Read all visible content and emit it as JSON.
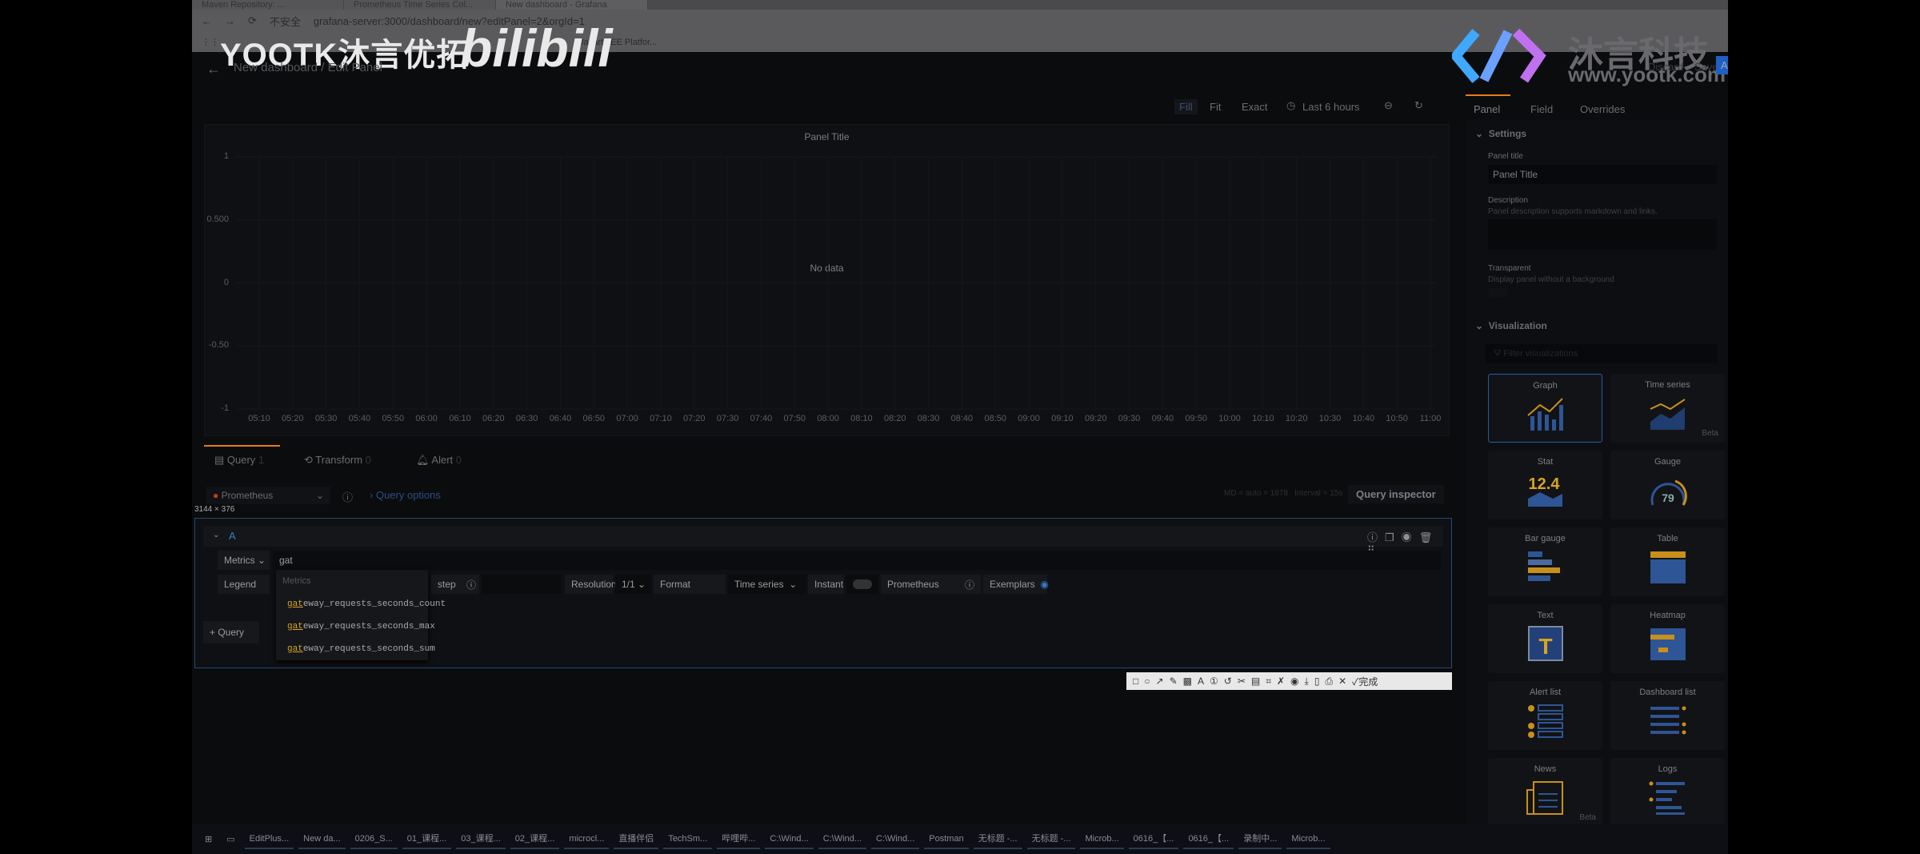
{
  "browser": {
    "tabs": [
      "Maven Repository: ...",
      "Prometheus Time Series Col...",
      "New dashboard - Grafana"
    ],
    "security": "不安全",
    "url": "grafana-server:3000/dashboard/new?editPanel=2&orgId=1",
    "bookmark": "Jakarta EE Platfor..."
  },
  "watermark": {
    "left": "YOOTK沐言优拓",
    "bili": "bilibili",
    "right_cn": "沐言科技",
    "right_url": "www.yootk.com"
  },
  "header": {
    "breadcrumb": "New dashboard / Edit Panel",
    "discard": "Discard",
    "save": "Save",
    "apply": "Apply"
  },
  "toolbar": {
    "fill": "Fill",
    "fit": "Fit",
    "exact": "Exact",
    "time_range": "Last 6 hours"
  },
  "panel": {
    "title": "Panel Title",
    "no_data": "No data"
  },
  "chart_data": {
    "type": "line",
    "title": "Panel Title",
    "y_ticks": [
      "1",
      "0.500",
      "0",
      "-0.50",
      "-1"
    ],
    "ylim": [
      -1,
      1
    ],
    "x_ticks": [
      "05:10",
      "05:20",
      "05:30",
      "05:40",
      "05:50",
      "06:00",
      "06:10",
      "06:20",
      "06:30",
      "06:40",
      "06:50",
      "07:00",
      "07:10",
      "07:20",
      "07:30",
      "07:40",
      "07:50",
      "08:00",
      "08:10",
      "08:20",
      "08:30",
      "08:40",
      "08:50",
      "09:00",
      "09:10",
      "09:20",
      "09:30",
      "09:40",
      "09:50",
      "10:00",
      "10:10",
      "10:20",
      "10:30",
      "10:40",
      "10:50",
      "11:00"
    ],
    "series": [],
    "grid": true,
    "annotation": "No data"
  },
  "query_tabs": [
    {
      "label": "Query",
      "count": "1"
    },
    {
      "label": "Transform",
      "count": "0"
    },
    {
      "label": "Alert",
      "count": "0"
    }
  ],
  "datasource": {
    "name": "Prometheus",
    "query_options": "Query options",
    "md": "MD = auto = 1878",
    "interval": "Interval = 15s",
    "inspector": "Query inspector"
  },
  "selection_size": "3144 × 376",
  "query": {
    "ref": "A",
    "metrics_label": "Metrics",
    "metrics_value": "gat",
    "legend": "Legend",
    "step": "step",
    "resolution_label": "Resolution",
    "resolution": "1/1",
    "format_label": "Format",
    "format": "Time series",
    "instant": "Instant",
    "ds_type": "Prometheus",
    "exemplars": "Exemplars",
    "add_query": "Query"
  },
  "autocomplete": {
    "header": "Metrics",
    "match": "gat",
    "items": [
      "eway_requests_seconds_count",
      "eway_requests_seconds_max",
      "eway_requests_seconds_sum"
    ]
  },
  "screenshot_tool": {
    "done": "完成"
  },
  "options": {
    "tabs": [
      "Panel",
      "Field",
      "Overrides"
    ],
    "settings": "Settings",
    "panel_title_label": "Panel title",
    "panel_title_value": "Panel Title",
    "description_label": "Description",
    "description_help": "Panel description supports markdown and links.",
    "transparent_label": "Transparent",
    "transparent_help": "Display panel without a background",
    "visualization": "Visualization",
    "filter_placeholder": "Filter visualizations",
    "viz": [
      {
        "name": "Graph",
        "selected": true
      },
      {
        "name": "Time series",
        "beta": "Beta"
      },
      {
        "name": "Stat",
        "value": "12.4"
      },
      {
        "name": "Gauge",
        "value": "79"
      },
      {
        "name": "Bar gauge"
      },
      {
        "name": "Table"
      },
      {
        "name": "Text"
      },
      {
        "name": "Heatmap"
      },
      {
        "name": "Alert list"
      },
      {
        "name": "Dashboard list"
      },
      {
        "name": "News",
        "beta": "Beta"
      },
      {
        "name": "Logs"
      }
    ]
  },
  "taskbar": [
    "EditPlus...",
    "New da...",
    "0206_S...",
    "01_课程...",
    "03_课程...",
    "02_课程...",
    "microcl...",
    "直播伴侣",
    "TechSm...",
    "哔哩哔...",
    "C:\\Wind...",
    "C:\\Wind...",
    "C:\\Wind...",
    "Postman",
    "无标题 -...",
    "无标题 -...",
    "Microb...",
    "0616_【...",
    "0616_【...",
    "录制中...",
    "Microb..."
  ],
  "colors": {
    "accent": "#3274d9",
    "orange": "#f2a918",
    "selection": "#1d4a78"
  }
}
